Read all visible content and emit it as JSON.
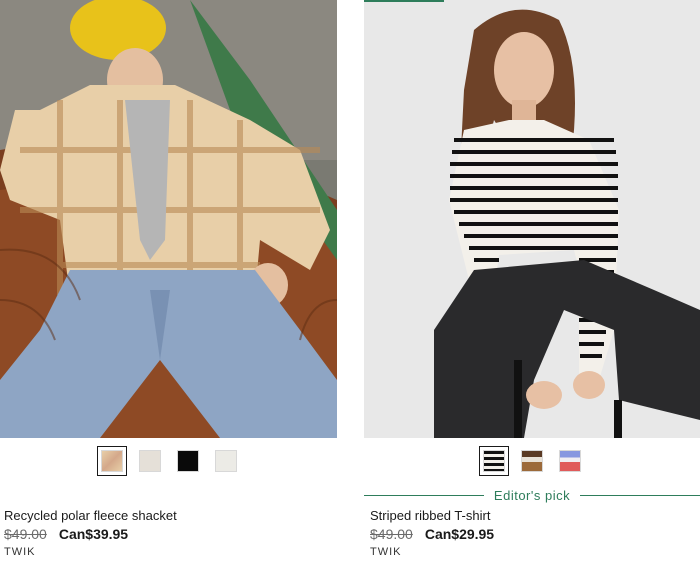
{
  "products": [
    {
      "name": "Recycled polar fleece shacket",
      "old_price": "$49.00",
      "new_price": "Can$39.95",
      "brand": "TWIK",
      "swatches": [
        {
          "label": "plaid beige",
          "color": "#d9b89a",
          "selected": true
        },
        {
          "label": "light beige",
          "color": "#e5e0d8",
          "selected": false
        },
        {
          "label": "black",
          "color": "#0a0a0a",
          "selected": false
        },
        {
          "label": "off white",
          "color": "#ecebe6",
          "selected": false
        }
      ]
    },
    {
      "name": "Striped ribbed T-shirt",
      "old_price": "$49.00",
      "new_price": "Can$29.95",
      "brand": "TWIK",
      "badge": "Editor's pick",
      "swatches": [
        {
          "label": "black white stripe",
          "color": "#1a1a1a",
          "selected": true
        },
        {
          "label": "brown stripe",
          "color": "#8a5a3a",
          "selected": false
        },
        {
          "label": "blue red stripe",
          "color": "#7a8fd9",
          "selected": false
        }
      ]
    }
  ],
  "colors": {
    "accent": "#2e7d5b",
    "text": "#1a1a1a"
  }
}
